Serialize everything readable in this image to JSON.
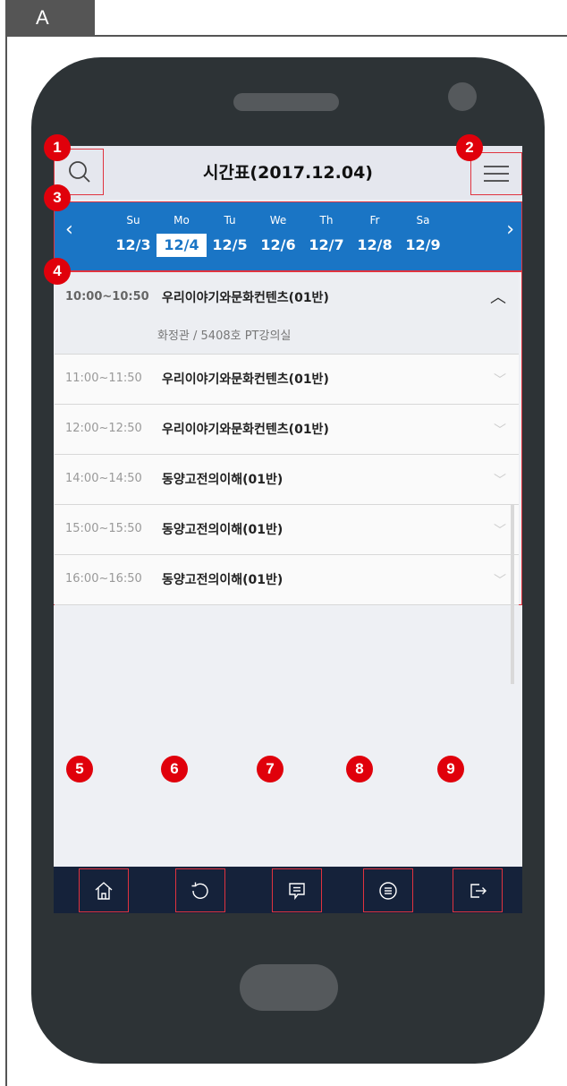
{
  "tab_label": "A",
  "header": {
    "title": "시간표(2017.12.04)"
  },
  "week": {
    "days": [
      {
        "dn": "Su",
        "date": "12/3"
      },
      {
        "dn": "Mo",
        "date": "12/4"
      },
      {
        "dn": "Tu",
        "date": "12/5"
      },
      {
        "dn": "We",
        "date": "12/6"
      },
      {
        "dn": "Th",
        "date": "12/7"
      },
      {
        "dn": "Fr",
        "date": "12/8"
      },
      {
        "dn": "Sa",
        "date": "12/9"
      }
    ],
    "selected": "12/4",
    "prev": "‹",
    "next": "›"
  },
  "classes": [
    {
      "time": "10:00~10:50",
      "name": "우리이야기와문화컨텐츠(01반)",
      "location": "화정관 / 5408호 PT강의실",
      "expanded": true
    },
    {
      "time": "11:00~11:50",
      "name": "우리이야기와문화컨텐츠(01반)"
    },
    {
      "time": "12:00~12:50",
      "name": "우리이야기와문화컨텐츠(01반)"
    },
    {
      "time": "14:00~14:50",
      "name": "동양고전의이해(01반)"
    },
    {
      "time": "15:00~15:50",
      "name": "동양고전의이해(01반)"
    },
    {
      "time": "16:00~16:50",
      "name": "동양고전의이해(01반)"
    }
  ],
  "badges": [
    "1",
    "2",
    "3",
    "4",
    "5",
    "6",
    "7",
    "8",
    "9"
  ],
  "nav_icons": [
    "home-icon",
    "refresh-icon",
    "message-icon",
    "list-icon",
    "logout-icon"
  ],
  "colors": {
    "accent": "#1a75c5",
    "navbar": "#15223a",
    "marker": "#e0000b",
    "outline": "#e0333f",
    "phone": "#2d3336"
  }
}
